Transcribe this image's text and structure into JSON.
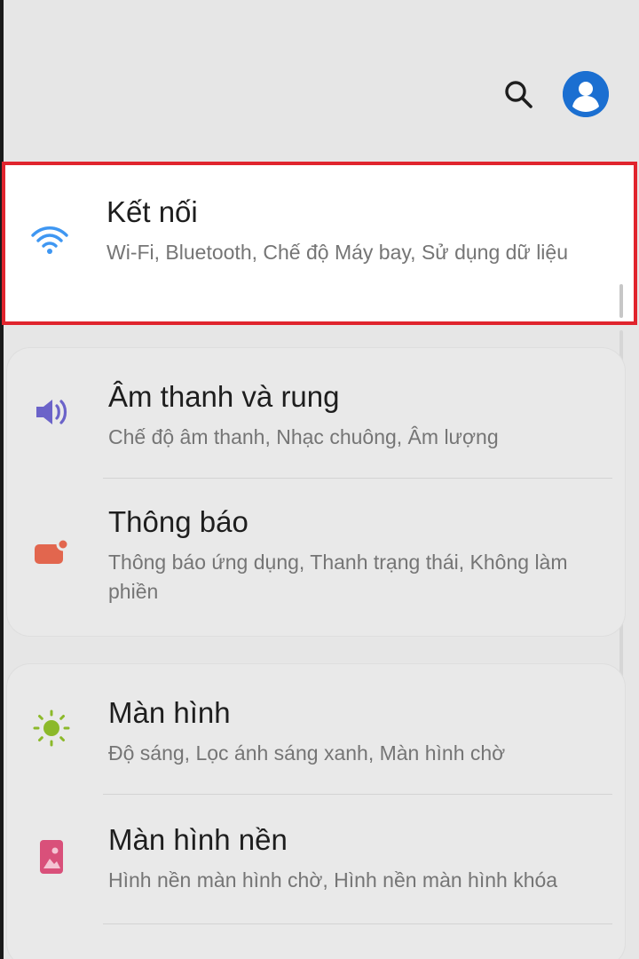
{
  "header": {
    "search_icon": "search-icon",
    "avatar_icon": "account-avatar-icon",
    "accent_color": "#1b6fd1"
  },
  "connections": {
    "title": "Kết nối",
    "subtitle": "Wi-Fi, Bluetooth, Chế độ Máy bay, Sử dụng dữ liệu",
    "icon": "wifi-icon",
    "icon_color": "#3f97f2",
    "highlight_color": "#e0242d"
  },
  "group_1": [
    {
      "title": "Âm thanh và rung",
      "subtitle": "Chế độ âm thanh, Nhạc chuông, Âm lượng",
      "icon": "speaker-icon",
      "icon_color": "#6b63c9"
    },
    {
      "title": "Thông báo",
      "subtitle": "Thông báo ứng dụng, Thanh trạng thái, Không làm phiền",
      "icon": "notification-icon",
      "icon_color": "#e2664e"
    }
  ],
  "group_2": [
    {
      "title": "Màn hình",
      "subtitle": "Độ sáng, Lọc ánh sáng xanh, Màn hình chờ",
      "icon": "brightness-icon",
      "icon_color": "#8cb92a"
    },
    {
      "title": "Màn hình nền",
      "subtitle": "Hình nền màn hình chờ, Hình nền màn hình khóa",
      "icon": "wallpaper-icon",
      "icon_color": "#d9507a"
    }
  ]
}
